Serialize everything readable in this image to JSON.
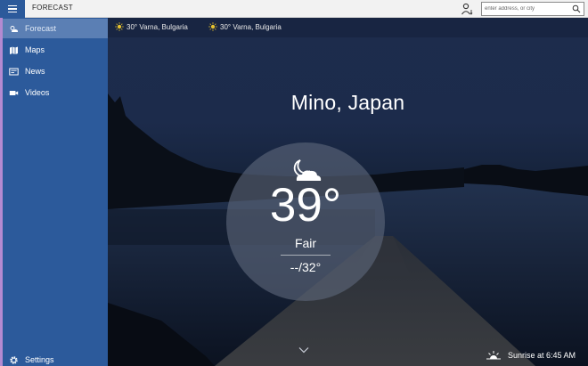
{
  "titlebar": {
    "app_title": "FORECAST",
    "user_icon": "location-person-icon"
  },
  "search": {
    "placeholder": "enter address, or city",
    "value": ""
  },
  "sidebar": {
    "items": [
      {
        "label": "Forecast",
        "icon": "sun-cloud-icon",
        "active": true
      },
      {
        "label": "Maps",
        "icon": "map-icon",
        "active": false
      },
      {
        "label": "News",
        "icon": "news-icon",
        "active": false
      },
      {
        "label": "Videos",
        "icon": "video-camera-icon",
        "active": false
      }
    ],
    "settings_label": "Settings"
  },
  "favorites": [
    {
      "label": "30° Varna, Bulgaria",
      "icon": "sun-icon"
    },
    {
      "label": "30° Varna, Bulgaria",
      "icon": "sun-icon"
    }
  ],
  "weather": {
    "city": "Mino, Japan",
    "temperature": "39°",
    "condition": "Fair",
    "hi_lo": "--/32°",
    "condition_icon": "moon-cloud-icon"
  },
  "footer": {
    "sunrise": "Sunrise at 6:45 AM"
  },
  "colors": {
    "sidebar": "#2c5a9b",
    "sidebar_active": "#5b7fb4",
    "accent_strip": "#b48ad1",
    "sun": "#e6c22e"
  }
}
